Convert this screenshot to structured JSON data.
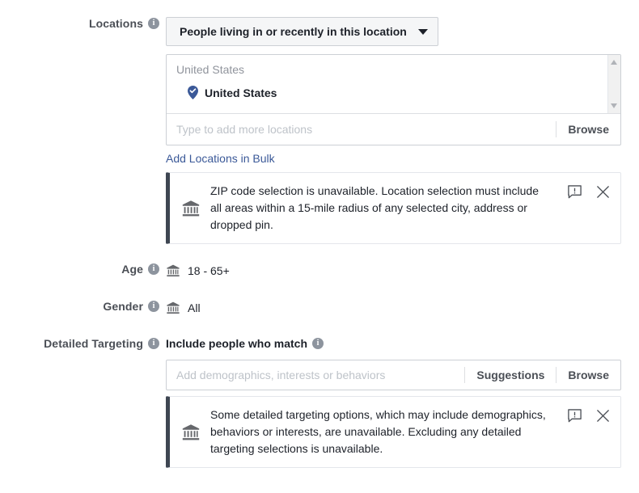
{
  "locations": {
    "label": "Locations",
    "info_icon": "info-icon",
    "dropdown": {
      "selected": "People living in or recently in this location",
      "caret_icon": "chevron-down-icon"
    },
    "selected_group_title": "United States",
    "selected_items": [
      {
        "name": "United States",
        "icon": "map-pin-check-icon"
      }
    ],
    "scrollbar": {
      "up_icon": "scroll-up-arrow-icon",
      "down_icon": "scroll-down-arrow-icon"
    },
    "search": {
      "value": "",
      "placeholder": "Type to add more locations"
    },
    "browse_label": "Browse",
    "bulk_link": "Add Locations in Bulk",
    "notice": {
      "icon": "bank-icon",
      "message": "ZIP code selection is unavailable. Location selection must include all areas within a 15-mile radius of any selected city, address or dropped pin.",
      "feedback_icon": "feedback-bubble-icon",
      "close_icon": "close-icon"
    }
  },
  "age": {
    "label": "Age",
    "icon": "bank-icon",
    "value": "18 - 65+"
  },
  "gender": {
    "label": "Gender",
    "icon": "bank-icon",
    "value": "All"
  },
  "detailed_targeting": {
    "label": "Detailed Targeting",
    "heading": "Include people who match",
    "search": {
      "value": "",
      "placeholder": "Add demographics, interests or behaviors"
    },
    "suggestions_label": "Suggestions",
    "browse_label": "Browse",
    "notice": {
      "icon": "bank-icon",
      "message": "Some detailed targeting options, which may include demographics, behaviors or interests, are unavailable. Excluding any detailed targeting selections is unavailable.",
      "feedback_icon": "feedback-bubble-icon",
      "close_icon": "close-icon"
    }
  },
  "colors": {
    "link": "#3b5998",
    "label_text": "#4b4f56",
    "placeholder": "#bec3c9",
    "notice_border": "#3e4652",
    "pin": "#3b5998",
    "field_border": "#ccd0d5"
  }
}
